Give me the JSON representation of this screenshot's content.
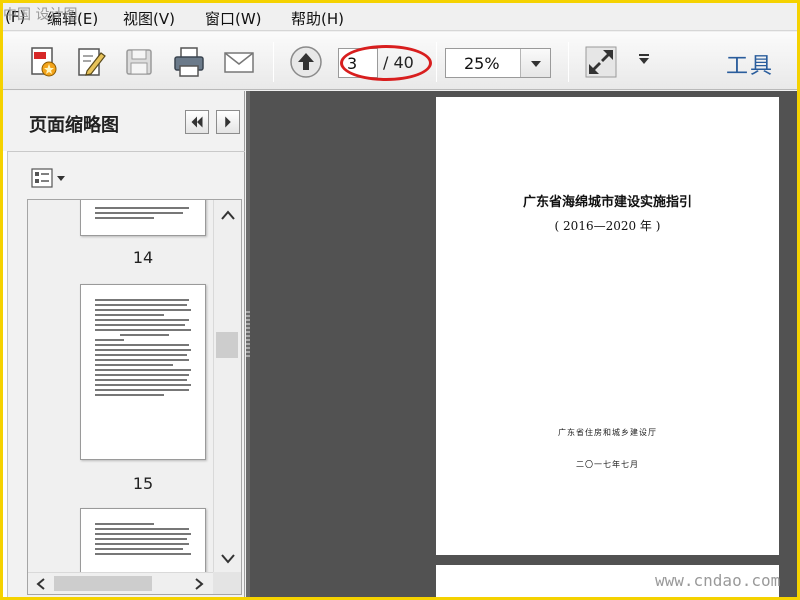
{
  "menu": {
    "items": [
      {
        "label": "编辑(E)"
      },
      {
        "label": "视图(V)"
      },
      {
        "label": "窗口(W)"
      },
      {
        "label": "帮助(H)"
      }
    ],
    "partial_left": "(F)"
  },
  "watermark_top_left": "中国 设计图",
  "toolbar": {
    "buttons": [
      "create-pdf-icon",
      "edit-sign-icon",
      "save-icon",
      "print-icon",
      "email-icon",
      "page-up-icon"
    ],
    "page_current": "3",
    "page_total": "/ 40",
    "zoom": "25%",
    "tools_label": "工具",
    "highlight_color": "#d81e1e"
  },
  "thumbnail_panel": {
    "title": "页面缩略图",
    "pages": [
      {
        "number": "14"
      },
      {
        "number": "15"
      }
    ]
  },
  "document": {
    "title": "广东省海绵城市建设实施指引",
    "years": "( 2016—2020 年 )",
    "organization": "广东省住房和城乡建设厅",
    "date": "二〇一七年七月"
  },
  "watermark_bottom_right": "www.cndao.com"
}
